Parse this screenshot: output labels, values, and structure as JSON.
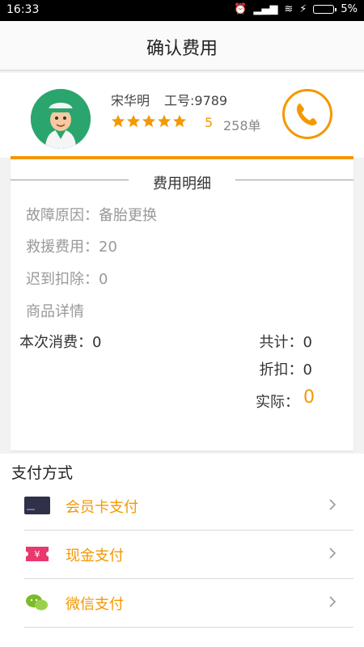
{
  "status": {
    "time": "16:33",
    "battery": "5%"
  },
  "header": {
    "title": "确认费用"
  },
  "driver": {
    "name": "宋华明",
    "id_label": "工号:9789",
    "rating": "5",
    "orders": "258单",
    "star_count": 5
  },
  "detail": {
    "title": "费用明细",
    "rows": [
      "故障原因：备胎更换",
      "救援费用：20",
      "迟到扣除：0",
      "商品详情"
    ],
    "consumption": "本次消费：0",
    "total": "共计：0",
    "discount": "折扣：0",
    "actual_label": "实际：",
    "actual_value": "0"
  },
  "payment": {
    "title": "支付方式",
    "items": [
      {
        "label": "会员卡支付",
        "icon": "card-icon"
      },
      {
        "label": "现金支付",
        "icon": "cash-icon"
      },
      {
        "label": "微信支付",
        "icon": "wechat-icon"
      }
    ]
  },
  "colors": {
    "accent": "#f39800",
    "avatar_bg": "#2aa56e"
  }
}
